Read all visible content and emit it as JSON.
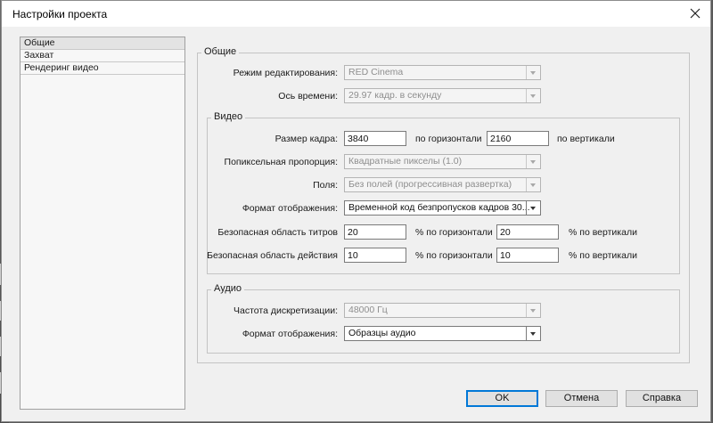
{
  "window": {
    "title": "Настройки проекта"
  },
  "sidebar": {
    "items": [
      {
        "label": "Общие",
        "selected": true
      },
      {
        "label": "Захват",
        "selected": false
      },
      {
        "label": "Рендеринг видео",
        "selected": false
      }
    ]
  },
  "general": {
    "group_label": "Общие",
    "edit_mode_label": "Режим редактирования:",
    "edit_mode_value": "RED Cinema",
    "timebase_label": "Ось времени:",
    "timebase_value": "29.97 кадр. в секунду"
  },
  "video": {
    "group_label": "Видео",
    "frame_size_label": "Размер кадра:",
    "frame_width": "3840",
    "horizontal_label": "по горизонтали",
    "frame_height": "2160",
    "vertical_label": "по вертикали",
    "pixel_aspect_label": "Попиксельная пропорция:",
    "pixel_aspect_value": "Квадратные пикселы (1.0)",
    "fields_label": "Поля:",
    "fields_value": "Без полей (прогрессивная развертка)",
    "display_format_label": "Формат отображения:",
    "display_format_value": "Временной код безпропусков кадров 30...",
    "title_safe_label": "Безопасная область титров",
    "title_safe_h": "20",
    "title_safe_h_unit": "% по горизонтали",
    "title_safe_v": "20",
    "title_safe_v_unit": "% по вертикали",
    "action_safe_label": "Безопасная область действия",
    "action_safe_h": "10",
    "action_safe_h_unit": "% по горизонтали",
    "action_safe_v": "10",
    "action_safe_v_unit": "% по вертикали"
  },
  "audio": {
    "group_label": "Аудио",
    "sample_rate_label": "Частота дискретизации:",
    "sample_rate_value": "48000 Гц",
    "display_format_label": "Формат отображения:",
    "display_format_value": "Образцы аудио"
  },
  "buttons": {
    "ok": "OK",
    "cancel": "Отмена",
    "help": "Справка"
  }
}
